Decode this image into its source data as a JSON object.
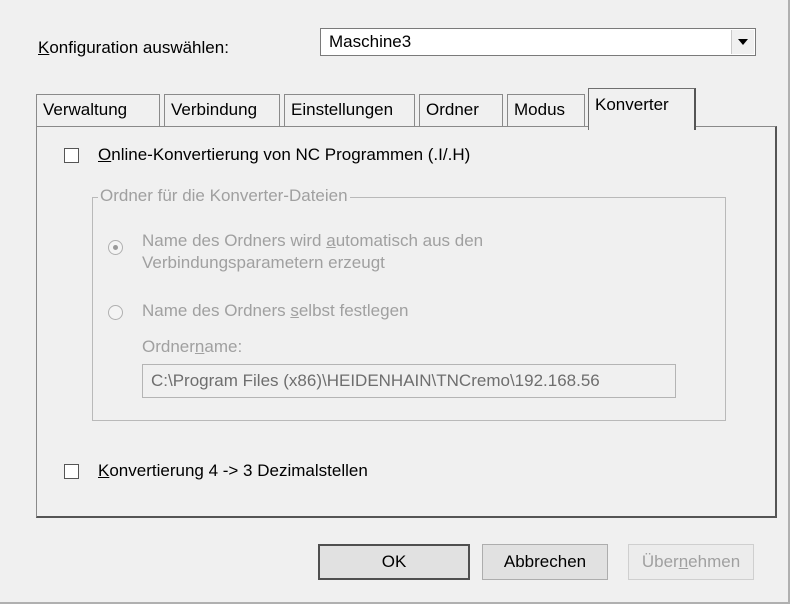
{
  "config": {
    "label_prefix": "",
    "label_access": "K",
    "label_rest": "onfiguration auswählen:",
    "selected": "Maschine3"
  },
  "tabs": [
    {
      "label": "Verwaltung"
    },
    {
      "label": "Verbindung"
    },
    {
      "label": "Einstellungen"
    },
    {
      "label": "Ordner"
    },
    {
      "label": "Modus"
    },
    {
      "label": "Konverter"
    }
  ],
  "panel": {
    "online_check": {
      "checked": false,
      "access": "O",
      "rest": "nline-Konvertierung von NC Programmen (.I/.H)"
    },
    "group_title": "Ordner für die Konverter-Dateien",
    "radio_auto": {
      "line1_pre": "Name des Ordners wird ",
      "line1_access": "a",
      "line1_post": "utomatisch aus den",
      "line2": "Verbindungsparametern erzeugt",
      "selected": true
    },
    "radio_manual": {
      "pre": "Name des Ordners ",
      "access": "s",
      "post": "elbst festlegen",
      "selected": false
    },
    "folder_label": {
      "pre": "Ordner",
      "access": "n",
      "post": "ame:"
    },
    "folder_path": "C:\\Program Files (x86)\\HEIDENHAIN\\TNCremo\\192.168.56",
    "decimal_check": {
      "checked": false,
      "access": "K",
      "rest": "onvertierung 4 -> 3 Dezimalstellen"
    }
  },
  "buttons": {
    "ok": "OK",
    "cancel": "Abbrechen",
    "apply_pre": "Über",
    "apply_access": "n",
    "apply_post": "ehmen"
  }
}
